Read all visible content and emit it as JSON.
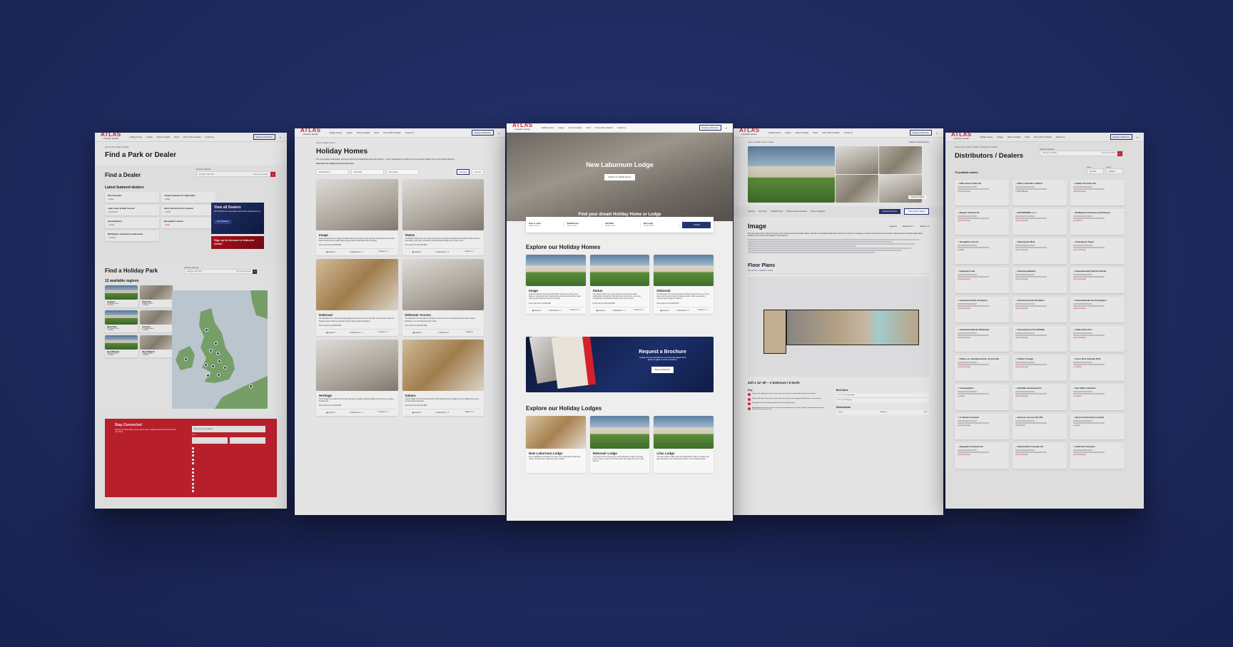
{
  "nav": {
    "logo": "ATLAS",
    "logo_sub": "LEISURE HOMES",
    "items": [
      "Holiday Homes",
      "Lodges",
      "News & Insights",
      "About",
      "Find a Park or Dealer",
      "Contact us"
    ],
    "cta": "Request a Brochure",
    "search_icon": "search-icon"
  },
  "colors": {
    "background": "#1f2a5e",
    "brand_red": "#d4202c",
    "brand_navy": "#24346e"
  },
  "find_park_dealer": {
    "breadcrumb": "Home / Find a Park or Dealer",
    "title": "Find a Park or Dealer",
    "dealer_heading": "Find a Dealer",
    "search_label": "Search by postcode",
    "search_placeholder": "Example: M41 8PD",
    "use_location": "Use current location",
    "featured_heading": "Latest featured dealers",
    "featured": [
      {
        "name": "Wm Caravans",
        "region": "Wales"
      },
      {
        "name": "Lloyds Caravan & Lodge Sales",
        "region": "Wales"
      },
      {
        "name": "Lake Coast & Dale Leisure",
        "region": "North West"
      },
      {
        "name": "Harry Farrell & Sons Limited",
        "region": "Ireland"
      },
      {
        "name": "Cunninghams",
        "region": "Ireland"
      },
      {
        "name": "Broughton Leisure",
        "region": "Wales"
      },
      {
        "name": "Bridlington Caravans (Lucihomes)",
        "region": "Yorkshire"
      }
    ],
    "view_all": {
      "title": "View all Dealers",
      "text": "We'll help find the nearest Atlas Leisure Home dealership to you.",
      "button": "View all dealers"
    },
    "signup": "Sign up to become a featured dealer",
    "park_heading": "Find a Holiday Park",
    "regions_count": "12 available regions",
    "regions": [
      {
        "name": "Scotland",
        "parks": "40 Holiday Parks",
        "dealers": "8 Dealers"
      },
      {
        "name": "North East",
        "parks": "6 Holiday Parks",
        "dealers": "1 Dealers"
      },
      {
        "name": "North West",
        "parks": "37 Holiday Parks",
        "dealers": "9 Dealers"
      },
      {
        "name": "Yorkshire",
        "parks": "17 Holiday Parks",
        "dealers": "3 Dealers"
      },
      {
        "name": "East Midlands",
        "parks": "8 Holiday Parks",
        "dealers": "1 Dealers"
      },
      {
        "name": "West Midlands",
        "parks": "7 Holiday Parks",
        "dealers": "2 Dealers"
      }
    ],
    "newsletter": {
      "title": "Stay Connected",
      "text": "Receive the latest Atlas Leisure Homes news, insights and product news direct to your inbox.",
      "email_placeholder": "Enter your email address",
      "name_label": "Name"
    }
  },
  "holiday_homes": {
    "breadcrumb": "Home / Holiday Homes",
    "title": "Holiday Homes",
    "intro": "The very highest build quality, stunning exteriors and beautifully appointed interiors – you're guaranteed to be able to find your dream holiday home in the 2024 collection.",
    "download_link": "Download our holiday home brochure here.",
    "filters": [
      "Bed/Bedrooms",
      "Max Width",
      "Max Length"
    ],
    "grid_view": "Grid view",
    "list_view": "List view",
    "models": [
      {
        "name": "Image",
        "desc": "Seasoned favourite the Image 10 Holiday Home has a variety of key features, including brushed metallic feature wall as well as stylish space saving multi-compartments built-in shelving.",
        "price": "Prices start from £72,995 RRP",
        "layouts": "Layouts 4",
        "bedrooms": "Bedrooms 2 - 3",
        "sleeps": "Sleeps 4 - 8"
      },
      {
        "name": "Status",
        "desc": "The Status 6 offers luxury open-plan living space and exudes sophistication throughout. With its famous round table, you'll enjoy entertaining in this beautiful holiday home all year round.",
        "price": "Prices start from £67,895 RRP",
        "layouts": "Layouts 3",
        "bedrooms": "Bedrooms 2 - 3",
        "sleeps": "Sleeps 6 - 8"
      },
      {
        "name": "Debonair",
        "desc": "Our Debonair 10 is a stunning looking holiday home and the envy of any park, and its interiors match its flawless exterior. With ever-popular country chique designs throughout.",
        "price": "Prices start from £49,995 RRP",
        "layouts": "Layouts 7",
        "bedrooms": "Bedrooms 2 - 3",
        "sleeps": "Sleeps 4 - 8"
      },
      {
        "name": "Debonair Access",
        "desc": "The Debonair 10 Access takes its design cues from the ever successful Debonair. With a roomier landscape, it is a wheelchair friendly model.",
        "price": "Prices start from £56,000 RRP",
        "layouts": "Layouts 1",
        "bedrooms": "Bedrooms 2",
        "sleeps": "Sleeps 6"
      },
      {
        "name": "Heritage",
        "desc": "The Heritage 5 the ideal choice for those wanting a versatile, spacious holiday home with an up-market, boutique feel.",
        "price": "Prices start from £47,000 RRP",
        "layouts": "Layouts 7",
        "bedrooms": "Bedrooms 2 - 3",
        "sleeps": "Sleeps 6 - 8"
      },
      {
        "name": "Sahara",
        "desc": "A good holiday home for the whole family. With botanical interior design cues, this holiday home has a trendy and fresh aesthetic.",
        "price": "Prices start from £42,000 RRP",
        "layouts": "Layouts 5",
        "bedrooms": "Bedrooms 2 - 3",
        "sleeps": "Sleeps 6 - 8"
      }
    ]
  },
  "home": {
    "hero_title": "New Laburnum Lodge",
    "hero_button": "Explore our Holiday Homes",
    "hero_sub": "Find your dream Holiday Home or Lodge",
    "search_fields": [
      {
        "label": "Home or Lodge",
        "value": "Please select"
      },
      {
        "label": "Bed/Bedrooms",
        "value": "Please select"
      },
      {
        "label": "Max Width",
        "value": "Please select"
      },
      {
        "label": "Max Length",
        "value": "Please select"
      }
    ],
    "search_button": "Search",
    "homes_heading": "Explore our Holiday Homes",
    "brochure": {
      "title": "Request a Brochure",
      "text": "Looking for more information on our homes and lodges? Click below to register to receive a brochure.",
      "button": "Request a Brochure"
    },
    "lodges_heading": "Explore our Holiday Lodges",
    "lodges": [
      {
        "name": "New Laburnum Lodge",
        "desc": "We are delighted to showcase the return of the sophisticated Laburnum Lodge. The Laburnum Lodge has an airy, modern"
      },
      {
        "name": "Debonair Lodge",
        "desc": "You'll want to show everyone your stylish Debonair Lodge 5. And with plenty of space, invite your friends to pack their bags and come to stay with you."
      },
      {
        "name": "Lilac Lodge",
        "desc": "The Lilac Lodge 10 offers style and sophistication. With its spacious and light living space, and contemporary kitchen, its the ultimate escape."
      }
    ]
  },
  "model_page": {
    "breadcrumb": "Home / Holiday Homes / Image",
    "back": "< Back to Holiday Homes",
    "view_photos": "View all 31 photos",
    "tabs": [
      "Overview",
      "Floor Plans",
      "3D Walkthrough",
      "Features & Optional Extras",
      "Features Highlights"
    ],
    "download": "Download brochure",
    "find": "Find a Park or Dealer",
    "title": "Image",
    "layouts": "Layouts 4",
    "bedrooms": "Bedrooms 2 - 3",
    "sleeps": "Sleeps 4 - 8",
    "body": "The focal point of the Image 10 lounge is the stunning brushed metallic feature wall with a contrasting black nickel electric fire surround. Including a luxurious 3-seat sofa, two armchairs, large footstool and high quality fitted furniture, this model oozes elegance and opulence.",
    "floor_heading": "Floor Plans",
    "floor_link": "41ft x 12' 6ft – 2 bedroom / 6 berth",
    "plan_title": "41ft x 12' 6ft – 2 bedroom / 6 berth",
    "key_heading": "Key",
    "key": [
      "Lounge with sliding patio doors, 3-seater sofa, two armchairs and matching footstool as standard.",
      "Kitchen with electric oven, grill, 5 burner hob and extractor hood, integrated fridge/freezer and microwave.",
      "Dining Area with freestanding dining table and upholstered chairs.",
      "Main Bathroom with Jack and Jill access from main bedroom has a Velux® rooflight, fitted wash basin, shower cubicle, WC and extractor fan."
    ],
    "bed_heading": "Bed Sizes",
    "beds": [
      "3' 0\" × 6' 3\" Large Single",
      "5' 0\" × 6' 3\" Kingsize"
    ],
    "dim_heading": "Dimensions",
    "dims": [
      {
        "k": "Length",
        "mm": "12,600mm",
        "ft": "41' 6\""
      }
    ]
  },
  "dealers": {
    "breadcrumb": "Home / Find a Park or Dealer / Distributors / Dealers",
    "title": "Distributors / Dealers",
    "search_label": "Search by postcode",
    "search_placeholder": "Example: M41 8PD",
    "use_location": "Use current location",
    "count": "70 available dealers",
    "radius_label": "Radius",
    "radius": "50 miles",
    "sort_label": "Sort by",
    "sort": "Distance",
    "list": [
      {
        "name": "ABI Leisure Parks SA",
        "region": "Rest of Europe"
      },
      {
        "name": "Albins Caravans Limited",
        "region": "West Midlands"
      },
      {
        "name": "Audibe Tourisme SA",
        "region": "Rest of Europe"
      },
      {
        "name": "Bergen Caravan AS",
        "region": "Rest of Europe"
      },
      {
        "name": "BYAKHOMES s.r.o.",
        "region": "Rest of Europe"
      },
      {
        "name": "Bridlington Caravans (Lucihomes)",
        "region": "Yorkshire"
      },
      {
        "name": "Broughton Leisure",
        "region": "Wales"
      },
      {
        "name": "Camping de Mole",
        "region": "Rest of Europe"
      },
      {
        "name": "Camping de Vogel",
        "region": "Rest of Europe"
      },
      {
        "name": "Camping Linde",
        "region": "Rest of Europe"
      },
      {
        "name": "Camping Rakeltes",
        "region": "Rest of Europe"
      },
      {
        "name": "Caravanbedrijf Twente Sollend",
        "region": "Rest of Europe"
      },
      {
        "name": "Caravancentrum Grevjeons",
        "region": "Rest of Europe"
      },
      {
        "name": "Caravancentrum Slotelkos",
        "region": "Rest of Europe"
      },
      {
        "name": "Caravanhandel de Grevelingen",
        "region": "Rest of Europe"
      },
      {
        "name": "Caravanhandel De Wielewaal",
        "region": "Rest of Europe"
      },
      {
        "name": "Caravanimport De Driftdijk",
        "region": "Rest of Europe"
      },
      {
        "name": "Chalet Store B.V.",
        "region": "Rest of Europe"
      },
      {
        "name": "Chalet- en caravancentrum de Voorstal",
        "region": "Rest of Europe"
      },
      {
        "name": "Chalets Troeger",
        "region": "Rest of Europe"
      },
      {
        "name": "Cross Nest Caravan Park",
        "region": "Yorkshire"
      },
      {
        "name": "Cunninghams",
        "region": "Ireland"
      },
      {
        "name": "Dobaillie Caravancentre",
        "region": "Rest of Europe"
      },
      {
        "name": "Dee Valley Caravans",
        "region": "Scotland"
      },
      {
        "name": "H. Sinders Caravan",
        "region": "Rest of Europe"
      },
      {
        "name": "Harrison Leisure UK LTD",
        "region": "North West"
      },
      {
        "name": "Harry Farrell & Sons Limited",
        "region": "Ireland"
      },
      {
        "name": "Haugeland Caravan AS",
        "region": "Rest of Europe"
      },
      {
        "name": "Holstad Bil & Caravan AS",
        "region": "Rest of Europe"
      },
      {
        "name": "Honk Pen Caravans",
        "region": "Rest of Europe"
      }
    ]
  }
}
